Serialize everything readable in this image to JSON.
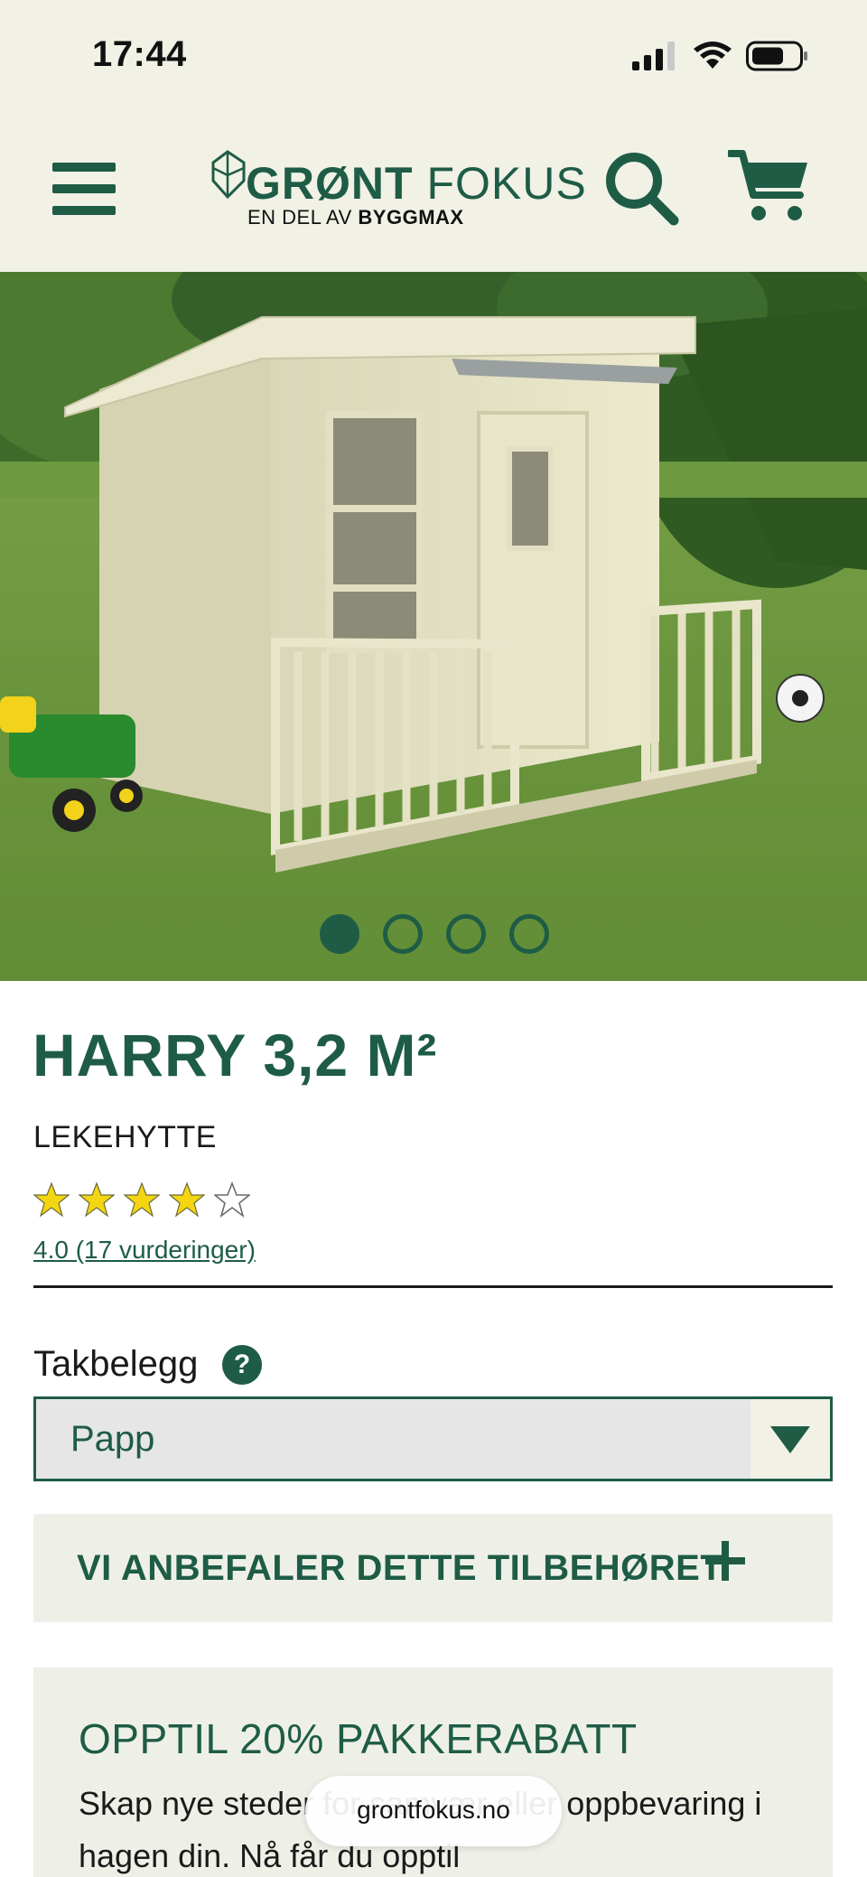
{
  "status_bar": {
    "time": "17:44"
  },
  "header": {
    "logo_name_bold": "GRØNT",
    "logo_name_light": "FOKUS",
    "logo_sub_prefix": "EN DEL AV",
    "logo_sub_brand": "BYGGMAX",
    "icons": [
      "menu-icon",
      "search-icon",
      "cart-icon"
    ]
  },
  "carousel": {
    "slides": 4,
    "active_index": 0
  },
  "product": {
    "title": "HARRY 3,2 M²",
    "subtitle": "LEKEHYTTE",
    "rating": 4.0,
    "rating_max": 5,
    "rating_link": "4.0 (17 vurderinger)"
  },
  "option": {
    "label": "Takbelegg",
    "help_symbol": "?",
    "selected": "Papp"
  },
  "accessories": {
    "title": "VI ANBEFALER DETTE TILBEHØRET"
  },
  "discount": {
    "title": "OPPTIL 20% PAKKERABATT",
    "body": "Skap nye steder for samvær eller oppbevaring i hagen din. Nå får du opptil"
  },
  "browser": {
    "url": "grontfokus.no"
  },
  "colors": {
    "brand_green": "#1e5c46",
    "header_bg": "#f1f1e6",
    "panel_bg": "#eef0e8",
    "star_yellow": "#f3d512"
  }
}
